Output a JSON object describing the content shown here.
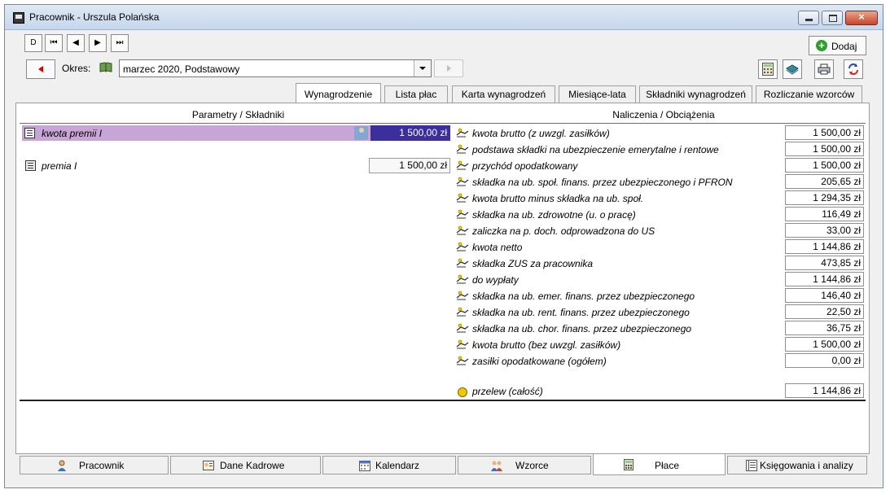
{
  "window": {
    "title": "Pracownik - Urszula Polańska",
    "close_glyph": "×"
  },
  "toolbar": {
    "nav": [
      "D",
      "⏮",
      "◀",
      "▶",
      "⏭"
    ],
    "add_label": "Dodaj"
  },
  "period": {
    "label": "Okres:",
    "value": "marzec 2020, Podstawowy"
  },
  "tabs_top": [
    "Wynagrodzenie",
    "Lista płac",
    "Karta wynagrodzeń",
    "Miesiące-lata",
    "Składniki wynagrodzeń",
    "Rozliczanie wzorców"
  ],
  "active_top_tab": "Wynagrodzenie",
  "panel": {
    "left_header": "Parametry / Składniki",
    "right_header": "Naliczenia / Obciążenia",
    "params": [
      {
        "label": "kwota premii I",
        "value": "1 500,00 zł"
      },
      {
        "label": "premia I",
        "value": "1 500,00 zł"
      }
    ],
    "naliczenia": [
      {
        "label": "kwota brutto (z uwzgl. zasiłków)",
        "value": "1 500,00 zł"
      },
      {
        "label": "podstawa składki na ubezpieczenie emerytalne i rentowe",
        "value": "1 500,00 zł"
      },
      {
        "label": "przychód opodatkowany",
        "value": "1 500,00 zł"
      },
      {
        "label": "składka na ub. społ. finans. przez ubezpieczonego i PFRON",
        "value": "205,65 zł"
      },
      {
        "label": "kwota brutto minus składka na ub. społ.",
        "value": "1 294,35 zł"
      },
      {
        "label": "składka na ub. zdrowotne (u. o pracę)",
        "value": "116,49 zł"
      },
      {
        "label": "zaliczka na p. doch. odprowadzona do US",
        "value": "33,00 zł"
      },
      {
        "label": "kwota netto",
        "value": "1 144,86 zł"
      },
      {
        "label": "składka ZUS za pracownika",
        "value": "473,85 zł"
      },
      {
        "label": "do wypłaty",
        "value": "1 144,86 zł"
      },
      {
        "label": "składka na ub. emer. finans. przez ubezpieczonego",
        "value": "146,40 zł"
      },
      {
        "label": "składka na ub. rent. finans. przez ubezpieczonego",
        "value": "22,50 zł"
      },
      {
        "label": "składka na ub. chor. finans. przez ubezpieczonego",
        "value": "36,75 zł"
      },
      {
        "label": "kwota brutto (bez uwzgl. zasiłków)",
        "value": "1 500,00 zł"
      },
      {
        "label": "zasiłki opodatkowane (ogółem)",
        "value": "0,00 zł"
      }
    ],
    "przelew": {
      "label": "przelew (całość)",
      "value": "1 144,86 zł"
    }
  },
  "tabs_bottom": [
    "Pracownik",
    "Dane Kadrowe",
    "Kalendarz",
    "Wzorce",
    "Płace",
    "Księgowania i analizy"
  ],
  "active_bottom_tab": "Płace"
}
